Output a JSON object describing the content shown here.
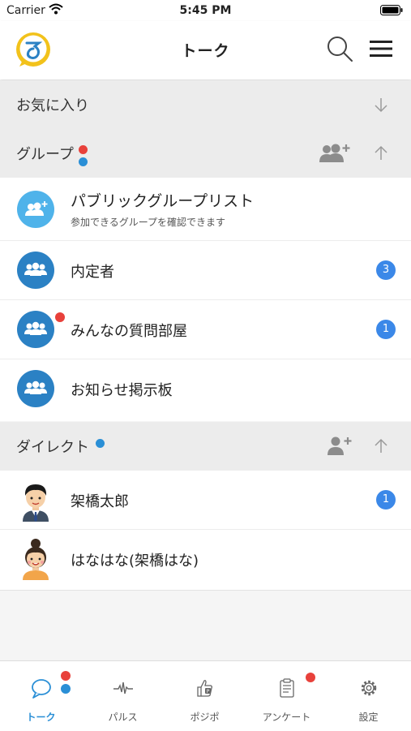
{
  "status_bar": {
    "carrier": "Carrier",
    "time": "5:45 PM"
  },
  "header": {
    "title": "トーク"
  },
  "sections": {
    "favorites": {
      "label": "お気に入り"
    },
    "groups": {
      "label": "グループ"
    },
    "direct": {
      "label": "ダイレクト"
    }
  },
  "groups": [
    {
      "name": "パブリックグループリスト",
      "subtitle": "参加できるグループを確認できます"
    },
    {
      "name": "内定者",
      "badge": "3"
    },
    {
      "name": "みんなの質問部屋",
      "badge": "1"
    },
    {
      "name": "お知らせ掲示板"
    }
  ],
  "direct": [
    {
      "name": "架橋太郎",
      "badge": "1"
    },
    {
      "name": "はなはな(架橋はな)"
    }
  ],
  "tabs": [
    {
      "label": "トーク",
      "icon": "chat-bubble-icon"
    },
    {
      "label": "パルス",
      "icon": "pulse-icon"
    },
    {
      "label": "ポジポ",
      "icon": "thumbs-up-icon"
    },
    {
      "label": "アンケート",
      "icon": "clipboard-icon"
    },
    {
      "label": "設定",
      "icon": "gear-icon"
    }
  ],
  "colors": {
    "accent": "#2a8fd6",
    "badge": "#3b88e8",
    "notification_red": "#e8413b",
    "notification_blue": "#2a8fd6",
    "section_bg": "#ececec"
  }
}
